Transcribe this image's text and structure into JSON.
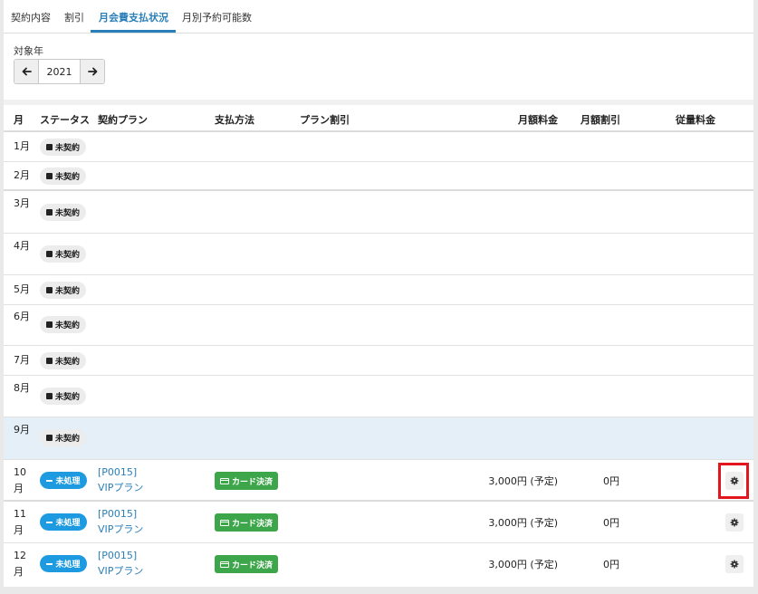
{
  "tabs": [
    {
      "label": "契約内容",
      "active": false
    },
    {
      "label": "割引",
      "active": false
    },
    {
      "label": "月会費支払状況",
      "active": true
    },
    {
      "label": "月別予約可能数",
      "active": false
    }
  ],
  "year_selector": {
    "label": "対象年",
    "value": "2021"
  },
  "table": {
    "headers": {
      "month": "月",
      "status": "ステータス",
      "plan": "契約プラン",
      "payment": "支払方法",
      "plan_discount": "プラン割引",
      "monthly_fee": "月額料金",
      "monthly_discount": "月額割引",
      "usage_fee": "従量料金"
    },
    "rows": [
      {
        "month": "1月",
        "status": "未契約"
      },
      {
        "month": "2月",
        "status": "未契約"
      },
      {
        "month": "3月",
        "status": "未契約"
      },
      {
        "month": "4月",
        "status": "未契約"
      },
      {
        "month": "5月",
        "status": "未契約"
      },
      {
        "month": "6月",
        "status": "未契約"
      },
      {
        "month": "7月",
        "status": "未契約"
      },
      {
        "month": "8月",
        "status": "未契約"
      },
      {
        "month": "9月",
        "status": "未契約"
      },
      {
        "month": "10月",
        "status": "未処理",
        "plan_code": "[P0015]",
        "plan_name": "VIPプラン",
        "payment": "カード決済",
        "fee": "3,000円 (予定)",
        "discount": "0円"
      },
      {
        "month": "11月",
        "status": "未処理",
        "plan_code": "[P0015]",
        "plan_name": "VIPプラン",
        "payment": "カード決済",
        "fee": "3,000円 (予定)",
        "discount": "0円"
      },
      {
        "month": "12月",
        "status": "未処理",
        "plan_code": "[P0015]",
        "plan_name": "VIPプラン",
        "payment": "カード決済",
        "fee": "3,000円 (予定)",
        "discount": "0円"
      }
    ]
  },
  "icons": {
    "prev": "arrow-left-icon",
    "next": "arrow-right-icon",
    "settings": "gear-icon",
    "card": "credit-card-icon"
  },
  "colors": {
    "accent": "#2a7fb8",
    "status_blue": "#1e9be0",
    "payment_green": "#3da54a",
    "highlight": "#e3161d"
  }
}
